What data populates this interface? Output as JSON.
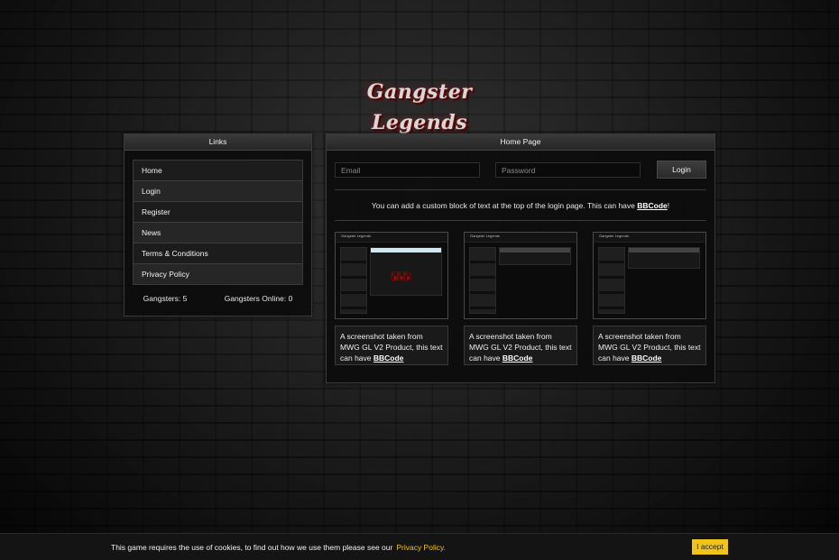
{
  "logo": {
    "text": "Gangster Legends"
  },
  "links_panel": {
    "title": "Links",
    "items": [
      {
        "label": "Home"
      },
      {
        "label": "Login"
      },
      {
        "label": "Register"
      },
      {
        "label": "News"
      },
      {
        "label": "Terms & Conditions"
      },
      {
        "label": "Privacy Policy"
      }
    ],
    "stats": {
      "gangsters": "Gangsters: 5",
      "online": "Gangsters Online: 0"
    }
  },
  "home_panel": {
    "title": "Home Page",
    "email_placeholder": "Email",
    "password_placeholder": "Password",
    "login_button": "Login",
    "custom_text": "You can add a custom block of text at the top of the login page. This can have",
    "custom_link": "BBCode",
    "custom_suffix": "!",
    "screenshots": [
      {
        "caption": "A screenshot taken from MWG GL V2 Product, this text can have",
        "link": "BBCode",
        "mini_logo": "Gangster Legends"
      },
      {
        "caption": "A screenshot taken from MWG GL V2 Product, this text can have",
        "link": "BBCode",
        "mini_logo": "Gangster Legends"
      },
      {
        "caption": "A screenshot taken from MWG GL V2 Product, this text can have",
        "link": "BBCode",
        "mini_logo": "Gangster Legends"
      }
    ]
  },
  "cookie_bar": {
    "text": "This game requires the use of cookies, to find out how we use them please see our",
    "link": "Privacy Policy.",
    "accept": "I accept"
  },
  "colors": {
    "accent": "#f0c419",
    "panel_bg": "#0c0c0c"
  }
}
